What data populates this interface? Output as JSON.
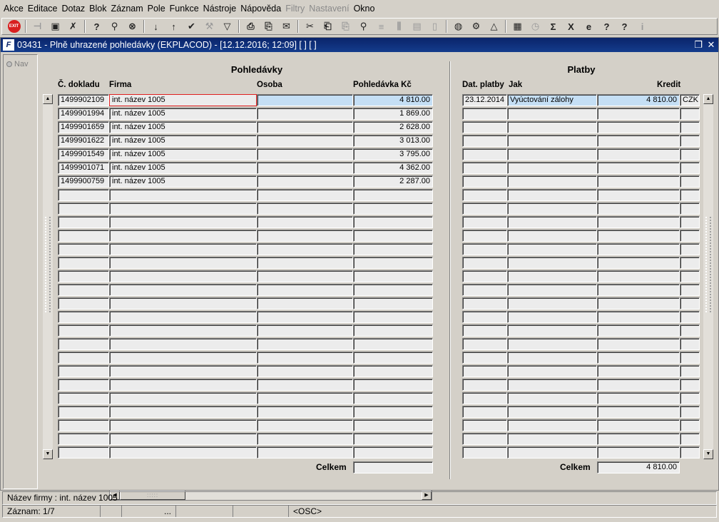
{
  "menu": [
    "Akce",
    "Editace",
    "Dotaz",
    "Blok",
    "Záznam",
    "Pole",
    "Funkce",
    "Nástroje",
    "Nápověda",
    "Filtry",
    "Nastavení",
    "Okno"
  ],
  "menu_disabled": [
    "Filtry",
    "Nastavení"
  ],
  "toolbar": {
    "exit_label": "EXIT",
    "icons": [
      "exit-icon",
      "pin-icon",
      "save-icon",
      "delete-row-icon",
      "query-icon",
      "execute-query-icon",
      "cancel-query-icon",
      "sort-asc-icon",
      "sort-desc-icon",
      "check-icon",
      "wrench-icon",
      "filter-icon",
      "print-icon",
      "print-preview-icon",
      "mail-icon",
      "cut-icon",
      "paste-icon",
      "copy-icon",
      "find-icon",
      "indent-icon",
      "columns-icon",
      "clipboard-icon",
      "document-icon",
      "globe-icon",
      "settings-icon",
      "warning-icon",
      "chart-icon",
      "clock-icon",
      "sum-icon",
      "excel-icon",
      "internet-icon",
      "help-question-icon",
      "help-icon",
      "info-icon"
    ]
  },
  "window": {
    "title": "03431 - Plně uhrazené pohledávky (EKPLACOD) - [12.12.2016; 12:09]  [ ]  [ ]",
    "restore_glyph": "❐",
    "close_glyph": "✕"
  },
  "nav_label": "Nav",
  "pohledavky": {
    "title": "Pohledávky",
    "headers": {
      "doklad": "Č. dokladu",
      "firma": "Firma",
      "osoba": "Osoba",
      "castka": "Pohledávka Kč"
    },
    "rows": [
      {
        "doklad": "1499902109",
        "firma": "int. název 1005",
        "osoba": "",
        "castka": "4 810.00"
      },
      {
        "doklad": "1499901994",
        "firma": "int. název 1005",
        "osoba": "",
        "castka": "1 869.00"
      },
      {
        "doklad": "1499901659",
        "firma": "int. název 1005",
        "osoba": "",
        "castka": "2 628.00"
      },
      {
        "doklad": "1499901622",
        "firma": "int. název 1005",
        "osoba": "",
        "castka": "3 013.00"
      },
      {
        "doklad": "1499901549",
        "firma": "int. název 1005",
        "osoba": "",
        "castka": "3 795.00"
      },
      {
        "doklad": "1499901071",
        "firma": "int. název 1005",
        "osoba": "",
        "castka": "4 362.00"
      },
      {
        "doklad": "1499900759",
        "firma": "int. název 1005",
        "osoba": "",
        "castka": "2 287.00"
      }
    ],
    "total_label": "Celkem",
    "total_value": ""
  },
  "platby": {
    "title": "Platby",
    "headers": {
      "datum": "Dat. platby",
      "jak": "Jak",
      "kredit": "Kredit",
      "mena": ""
    },
    "rows": [
      {
        "datum": "23.12.2014",
        "jak": "Vyúctování zálohy",
        "kredit": "4 810.00",
        "mena": "CZK"
      }
    ],
    "total_label": "Celkem",
    "total_value": "4 810.00"
  },
  "status": {
    "line1": "Název firmy : int. název 1005",
    "zaznam": "Záznam: 1/7",
    "ellipsis": "...",
    "mode": "<OSC>"
  }
}
